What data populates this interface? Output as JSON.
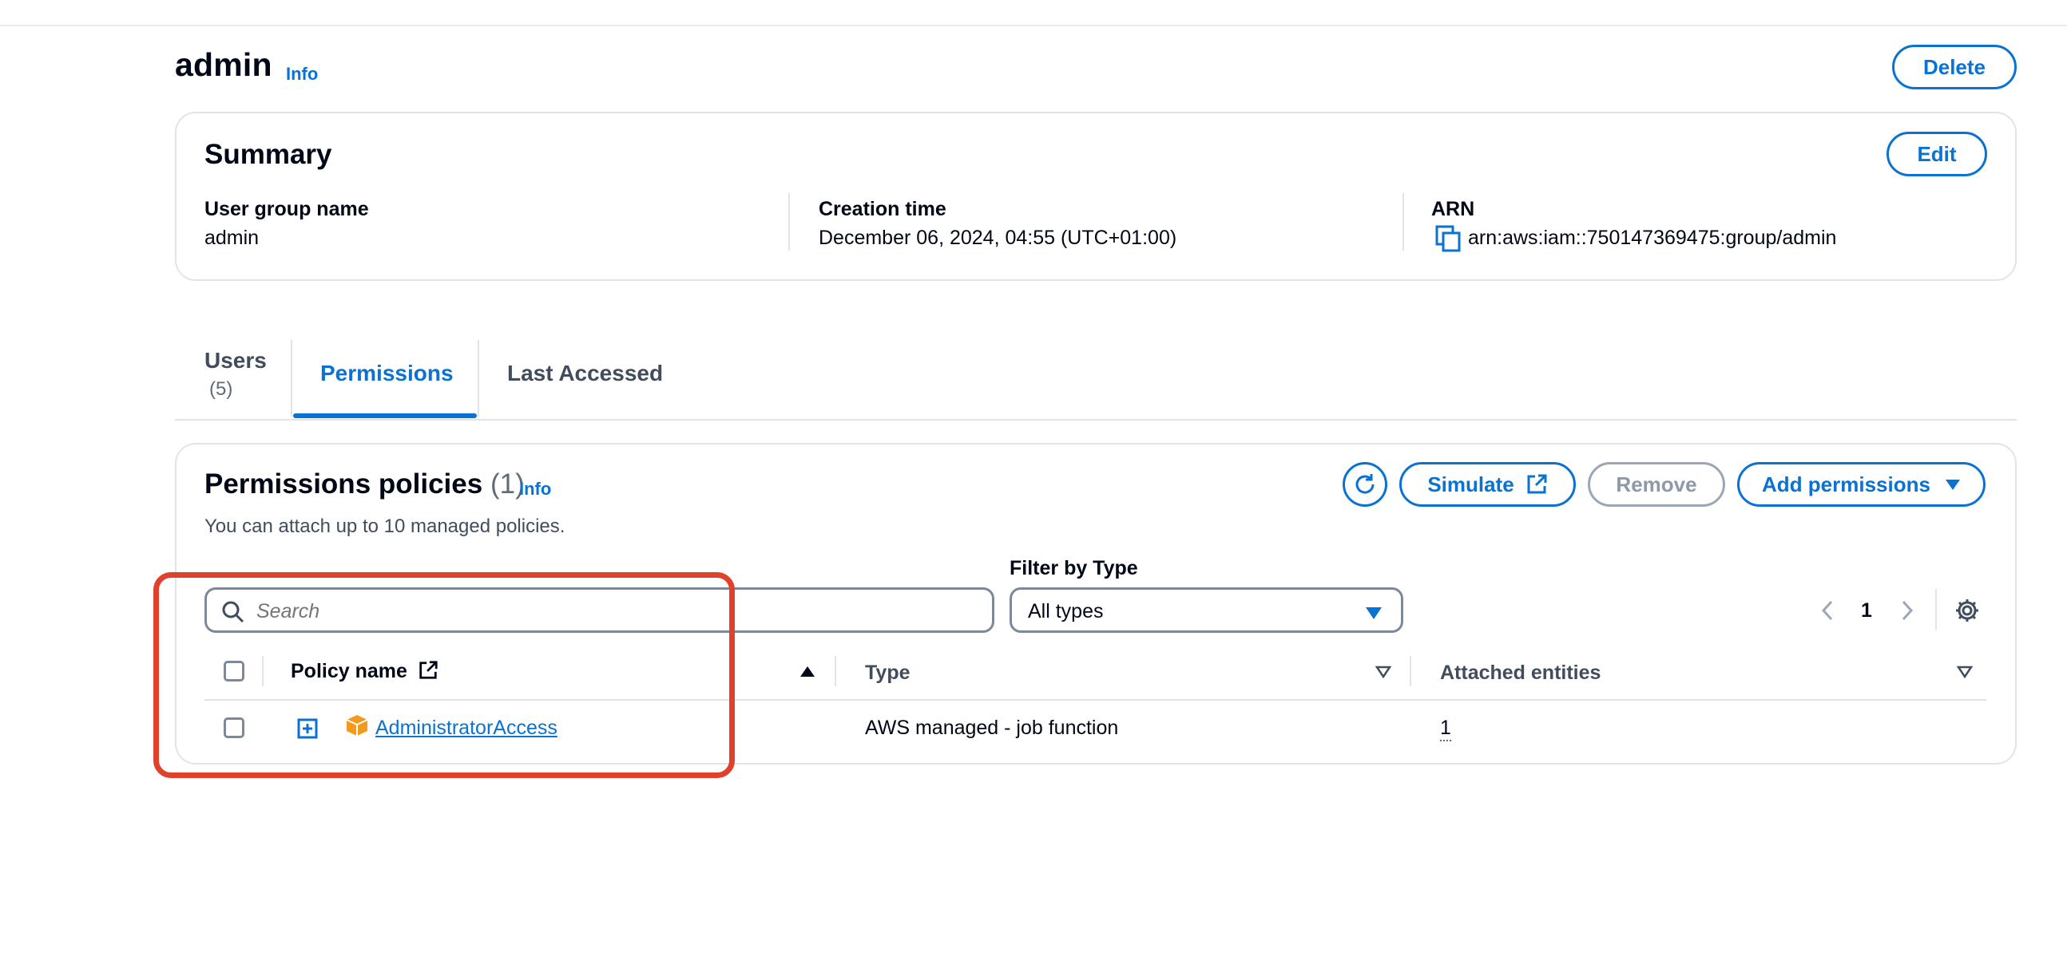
{
  "header": {
    "title": "admin",
    "info_label": "Info",
    "delete_label": "Delete"
  },
  "summary": {
    "heading": "Summary",
    "edit_label": "Edit",
    "fields": [
      {
        "label": "User group name",
        "value": "admin"
      },
      {
        "label": "Creation time",
        "value": "December 06, 2024, 04:55 (UTC+01:00)"
      },
      {
        "label": "ARN",
        "value": "arn:aws:iam::750147369475:group/admin"
      }
    ]
  },
  "tabs": [
    {
      "label": "Users",
      "count": "(5)",
      "active": false
    },
    {
      "label": "Permissions",
      "active": true
    },
    {
      "label": "Last Accessed",
      "active": false
    }
  ],
  "permissions": {
    "heading": "Permissions policies",
    "count": "(1)",
    "info_label": "Info",
    "description": "You can attach up to 10 managed policies.",
    "buttons": {
      "refresh_icon": "refresh-icon",
      "simulate": "Simulate",
      "remove": "Remove",
      "add_permissions": "Add permissions"
    },
    "search": {
      "placeholder": "Search"
    },
    "filter": {
      "label": "Filter by Type",
      "selected": "All types"
    },
    "pagination": {
      "current_page": "1"
    },
    "columns": [
      "Policy name",
      "Type",
      "Attached entities"
    ],
    "rows": [
      {
        "policy_name": "AdministratorAccess",
        "type": "AWS managed - job function",
        "attached_entities": "1"
      }
    ]
  },
  "colors": {
    "accent": "#0972d3",
    "highlight": "#e0412b",
    "policy_icon": "#f19a1c"
  }
}
